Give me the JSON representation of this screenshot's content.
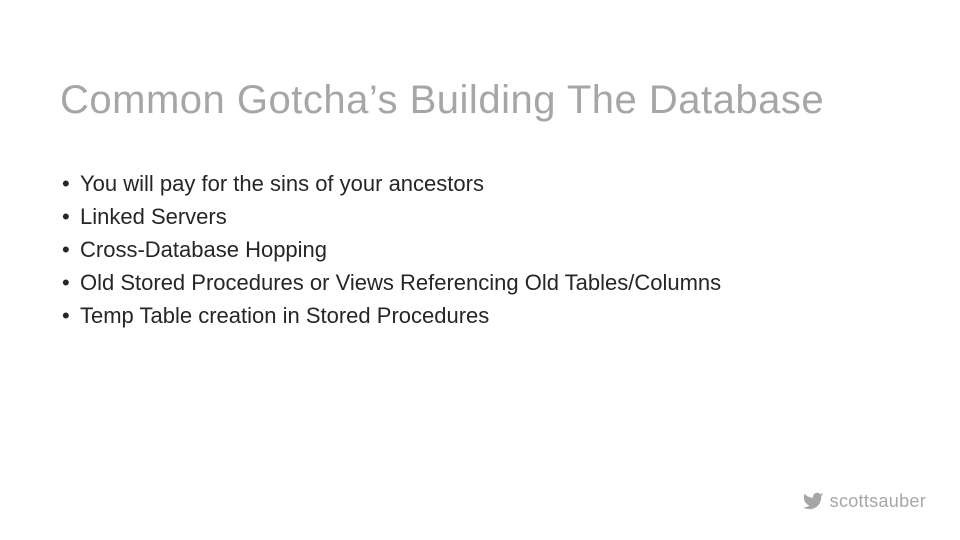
{
  "title": "Common Gotcha’s Building The Database",
  "bullets": [
    "You will pay for the sins of your ancestors",
    "Linked Servers",
    "Cross-Database Hopping",
    "Old Stored Procedures or Views Referencing Old Tables/Columns",
    "Temp Table creation in Stored Procedures"
  ],
  "footer": {
    "handle": "scottsauber"
  }
}
